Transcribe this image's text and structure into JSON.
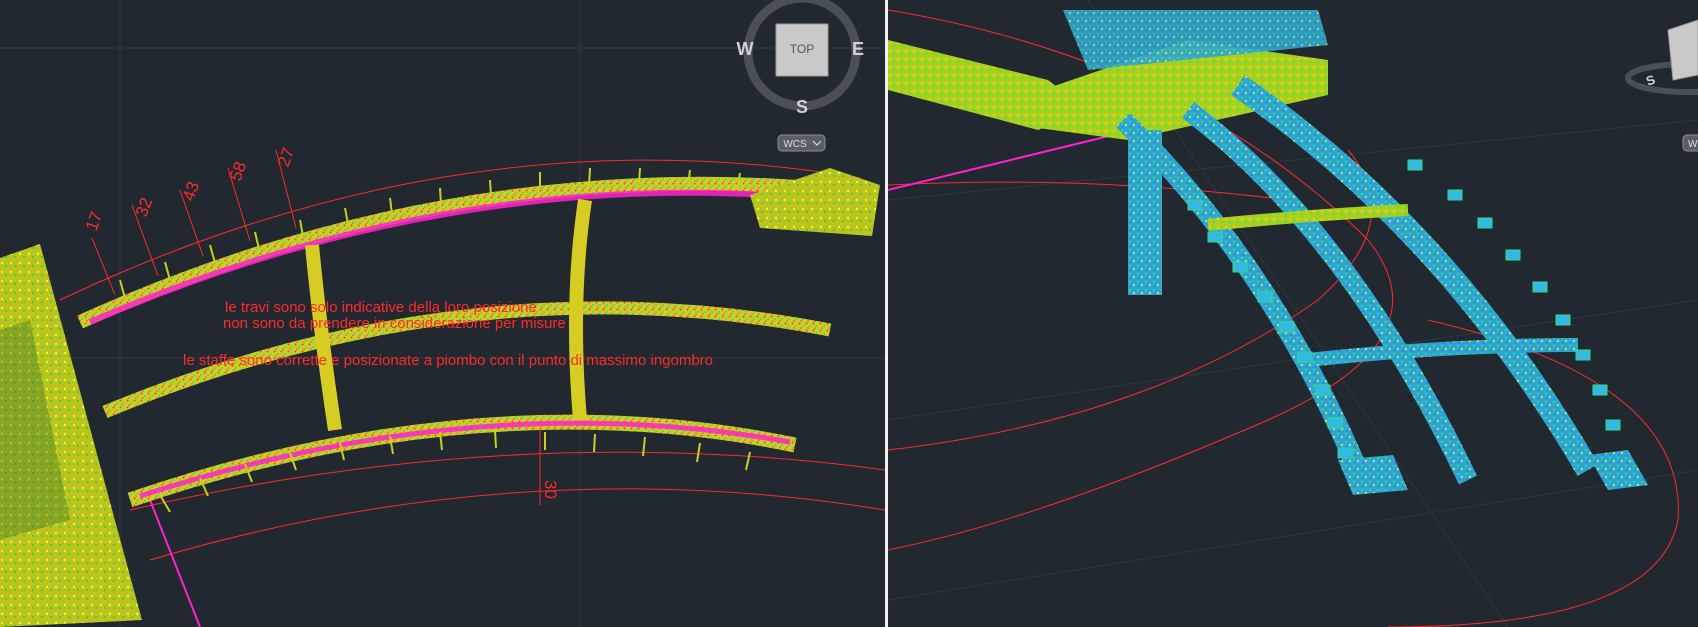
{
  "colors": {
    "background": "#212830",
    "grid": "#2e3744",
    "red": "#ff2a2a",
    "magenta": "#ff22cc",
    "viewcube_ring": "#4a4f58",
    "viewcube_face": "#c9c9c9"
  },
  "left_view": {
    "viewcube": {
      "top_label": "TOP",
      "north_label": "",
      "west_label": "W",
      "east_label": "E",
      "south_label": "S",
      "wcs_label": "WCS"
    },
    "dimensions": [
      "17",
      "32",
      "43",
      "58",
      "27"
    ],
    "dimension_bottom": "30",
    "notes": [
      "le travi sono solo indicative della loro posizione",
      "non sono da prendere in considerazione per misure",
      "le staffe sono corrette e posizionate a piombo con il punto di massimo ingombro"
    ]
  },
  "right_view": {
    "viewcube": {
      "south_label": "S",
      "wcs_label": "W"
    }
  }
}
